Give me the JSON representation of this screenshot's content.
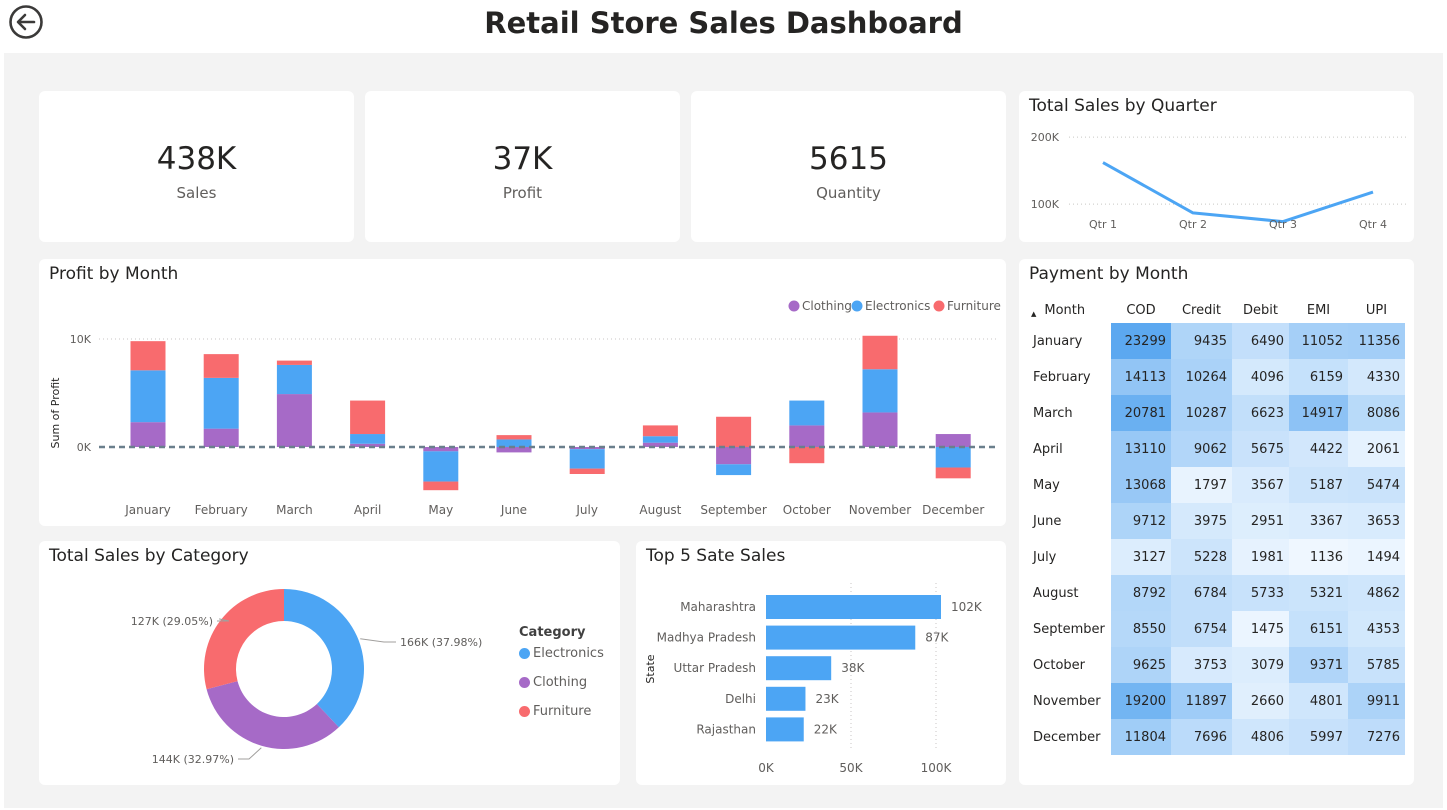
{
  "header": {
    "title": "Retail Store Sales Dashboard"
  },
  "kpis": [
    {
      "value": "438K",
      "label": "Sales"
    },
    {
      "value": "37K",
      "label": "Profit"
    },
    {
      "value": "5615",
      "label": "Quantity"
    }
  ],
  "colors": {
    "clothing": "#a66ac7",
    "electronics": "#4ca5f4",
    "furniture": "#f86b6e",
    "quarter_line": "#4ca5f4",
    "bar": "#4ca5f4"
  },
  "quarter_chart": {
    "title": "Total Sales by Quarter",
    "chart_data": {
      "type": "line",
      "categories": [
        "Qtr 1",
        "Qtr 2",
        "Qtr 3",
        "Qtr 4"
      ],
      "values": [
        162000,
        87000,
        74000,
        118000
      ],
      "ylim": [
        60000,
        215000
      ],
      "yticks": [
        {
          "value": 200000,
          "label": "200K"
        },
        {
          "value": 100000,
          "label": "100K"
        }
      ],
      "grid": true
    }
  },
  "profit_chart": {
    "title": "Profit by Month",
    "ylabel": "Sum of Profit",
    "chart_data": {
      "type": "bar",
      "stacked": true,
      "categories": [
        "January",
        "February",
        "March",
        "April",
        "May",
        "June",
        "July",
        "August",
        "September",
        "October",
        "November",
        "December"
      ],
      "series": [
        {
          "name": "Clothing",
          "values": [
            2300,
            1700,
            4900,
            300,
            -400,
            -500,
            -200,
            400,
            -1600,
            2000,
            3200,
            1200
          ]
        },
        {
          "name": "Electronics",
          "values": [
            4800,
            4700,
            2700,
            900,
            -2800,
            700,
            -1800,
            600,
            -1000,
            2300,
            4000,
            -1900
          ]
        },
        {
          "name": "Furniture",
          "values": [
            2700,
            2200,
            400,
            3100,
            -800,
            400,
            -500,
            1000,
            2800,
            -1500,
            3100,
            -1000
          ]
        }
      ],
      "ylim": [
        -4500,
        11000
      ],
      "yticks": [
        {
          "value": 10000,
          "label": "10K"
        },
        {
          "value": 0,
          "label": "0K"
        }
      ],
      "legend_position": "top-right",
      "grid": true
    }
  },
  "category_chart": {
    "title": "Total Sales by Category",
    "legend_title": "Category",
    "chart_data": {
      "type": "pie",
      "categories": [
        "Electronics",
        "Clothing",
        "Furniture"
      ],
      "values": [
        166000,
        144000,
        127000
      ],
      "percents": [
        37.98,
        32.97,
        29.05
      ],
      "labels": [
        "166K (37.98%)",
        "144K (32.97%)",
        "127K (29.05%)"
      ],
      "donut": true,
      "legend_position": "right"
    }
  },
  "state_chart": {
    "title": "Top 5 Sate Sales",
    "ylabel": "State",
    "chart_data": {
      "type": "bar",
      "orientation": "horizontal",
      "categories": [
        "Maharashtra",
        "Madhya Pradesh",
        "Uttar Pradesh",
        "Delhi",
        "Rajasthan"
      ],
      "values": [
        102000,
        87000,
        38000,
        23000,
        22000
      ],
      "value_labels": [
        "102K",
        "87K",
        "38K",
        "23K",
        "22K"
      ],
      "xlim": [
        0,
        102000
      ],
      "xticks": [
        {
          "value": 0,
          "label": "0K"
        },
        {
          "value": 50000,
          "label": "50K"
        },
        {
          "value": 100000,
          "label": "100K"
        }
      ],
      "grid": true
    }
  },
  "payment_table": {
    "title": "Payment by Month",
    "sort_icon": "sort-ascending-icon",
    "columns": [
      "Month",
      "COD",
      "Credit",
      "Debit",
      "EMI",
      "UPI"
    ],
    "chart_data": {
      "type": "table",
      "rows": [
        [
          "January",
          23299,
          9435,
          6490,
          11052,
          11356
        ],
        [
          "February",
          14113,
          10264,
          4096,
          6159,
          4330
        ],
        [
          "March",
          20781,
          10287,
          6623,
          14917,
          8086
        ],
        [
          "April",
          13110,
          9062,
          5675,
          4422,
          2061
        ],
        [
          "May",
          13068,
          1797,
          3567,
          5187,
          5474
        ],
        [
          "June",
          9712,
          3975,
          2951,
          3367,
          3653
        ],
        [
          "July",
          3127,
          5228,
          1981,
          1136,
          1494
        ],
        [
          "August",
          8792,
          6784,
          5733,
          5321,
          4862
        ],
        [
          "September",
          8550,
          6754,
          1475,
          6151,
          4353
        ],
        [
          "October",
          9625,
          3753,
          3079,
          9371,
          5785
        ],
        [
          "November",
          19200,
          11897,
          2660,
          4801,
          9911
        ],
        [
          "December",
          11804,
          7696,
          4806,
          5997,
          7276
        ]
      ]
    }
  }
}
